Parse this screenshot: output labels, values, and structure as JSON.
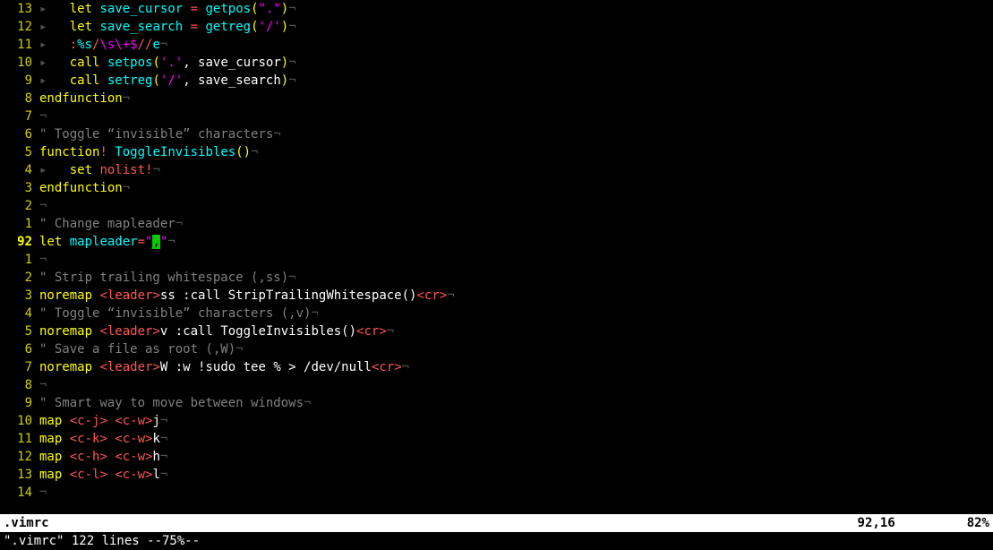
{
  "lines": [
    {
      "rel": "13",
      "current": false,
      "tokens": [
        [
          "tab",
          "▸   "
        ],
        [
          "kw",
          "let"
        ],
        [
          "plain",
          " "
        ],
        [
          "ident",
          "save_cursor"
        ],
        [
          "plain",
          " "
        ],
        [
          "op",
          "="
        ],
        [
          "plain",
          " "
        ],
        [
          "func",
          "getpos"
        ],
        [
          "paren",
          "("
        ],
        [
          "str",
          "\".\""
        ],
        [
          "paren",
          ")"
        ],
        [
          "eol",
          "¬"
        ]
      ]
    },
    {
      "rel": "12",
      "current": false,
      "tokens": [
        [
          "tab",
          "▸   "
        ],
        [
          "kw",
          "let"
        ],
        [
          "plain",
          " "
        ],
        [
          "ident",
          "save_search"
        ],
        [
          "plain",
          " "
        ],
        [
          "op",
          "="
        ],
        [
          "plain",
          " "
        ],
        [
          "func",
          "getreg"
        ],
        [
          "paren",
          "("
        ],
        [
          "str",
          "'/'"
        ],
        [
          "paren",
          ")"
        ],
        [
          "eol",
          "¬"
        ]
      ]
    },
    {
      "rel": "11",
      "current": false,
      "tokens": [
        [
          "tab",
          "▸   "
        ],
        [
          "op",
          ":"
        ],
        [
          "func",
          "%s"
        ],
        [
          "op",
          "/"
        ],
        [
          "str",
          "\\s\\+$"
        ],
        [
          "op",
          "//"
        ],
        [
          "func",
          "e"
        ],
        [
          "eol",
          "¬"
        ]
      ]
    },
    {
      "rel": "10",
      "current": false,
      "tokens": [
        [
          "tab",
          "▸   "
        ],
        [
          "kw",
          "call"
        ],
        [
          "plain",
          " "
        ],
        [
          "func",
          "setpos"
        ],
        [
          "paren",
          "("
        ],
        [
          "str",
          "'.'"
        ],
        [
          "plain",
          ", save_cursor"
        ],
        [
          "paren",
          ")"
        ],
        [
          "eol",
          "¬"
        ]
      ]
    },
    {
      "rel": "9",
      "current": false,
      "tokens": [
        [
          "tab",
          "▸   "
        ],
        [
          "kw",
          "call"
        ],
        [
          "plain",
          " "
        ],
        [
          "func",
          "setreg"
        ],
        [
          "paren",
          "("
        ],
        [
          "str",
          "'/'"
        ],
        [
          "plain",
          ", save_search"
        ],
        [
          "paren",
          ")"
        ],
        [
          "eol",
          "¬"
        ]
      ]
    },
    {
      "rel": "8",
      "current": false,
      "tokens": [
        [
          "kw",
          "endfunction"
        ],
        [
          "eol",
          "¬"
        ]
      ]
    },
    {
      "rel": "7",
      "current": false,
      "tokens": [
        [
          "eol",
          "¬"
        ]
      ]
    },
    {
      "rel": "6",
      "current": false,
      "tokens": [
        [
          "comment",
          "\" Toggle “invisible” characters"
        ],
        [
          "eol",
          "¬"
        ]
      ]
    },
    {
      "rel": "5",
      "current": false,
      "tokens": [
        [
          "kw",
          "function"
        ],
        [
          "op",
          "!"
        ],
        [
          "plain",
          " "
        ],
        [
          "func",
          "ToggleInvisibles"
        ],
        [
          "paren",
          "()"
        ],
        [
          "eol",
          "¬"
        ]
      ]
    },
    {
      "rel": "4",
      "current": false,
      "tokens": [
        [
          "tab",
          "▸   "
        ],
        [
          "kw",
          "set"
        ],
        [
          "plain",
          " "
        ],
        [
          "option",
          "nolist!"
        ],
        [
          "eol",
          "¬"
        ]
      ]
    },
    {
      "rel": "3",
      "current": false,
      "tokens": [
        [
          "kw",
          "endfunction"
        ],
        [
          "eol",
          "¬"
        ]
      ]
    },
    {
      "rel": "2",
      "current": false,
      "tokens": [
        [
          "eol",
          "¬"
        ]
      ]
    },
    {
      "rel": "1",
      "current": false,
      "tokens": [
        [
          "comment",
          "\" Change mapleader"
        ],
        [
          "eol",
          "¬"
        ]
      ]
    },
    {
      "rel": "92",
      "current": true,
      "tokens": [
        [
          "kw",
          "let"
        ],
        [
          "plain",
          " "
        ],
        [
          "ident",
          "mapleader"
        ],
        [
          "op",
          "="
        ],
        [
          "str",
          "\""
        ],
        [
          "cursor",
          ","
        ],
        [
          "str",
          "\""
        ],
        [
          "eol",
          "¬"
        ]
      ]
    },
    {
      "rel": "1",
      "current": false,
      "tokens": [
        [
          "eol",
          "¬"
        ]
      ]
    },
    {
      "rel": "2",
      "current": false,
      "tokens": [
        [
          "comment",
          "\" Strip trailing whitespace (,ss)"
        ],
        [
          "eol",
          "¬"
        ]
      ]
    },
    {
      "rel": "3",
      "current": false,
      "tokens": [
        [
          "kw",
          "noremap"
        ],
        [
          "plain",
          " "
        ],
        [
          "key",
          "<leader>"
        ],
        [
          "plain",
          "ss :call StripTrailingWhitespace()"
        ],
        [
          "key",
          "<cr>"
        ],
        [
          "eol",
          "¬"
        ]
      ]
    },
    {
      "rel": "4",
      "current": false,
      "tokens": [
        [
          "comment",
          "\" Toggle “invisible” characters (,v)"
        ],
        [
          "eol",
          "¬"
        ]
      ]
    },
    {
      "rel": "5",
      "current": false,
      "tokens": [
        [
          "kw",
          "noremap"
        ],
        [
          "plain",
          " "
        ],
        [
          "key",
          "<leader>"
        ],
        [
          "plain",
          "v :call ToggleInvisibles()"
        ],
        [
          "key",
          "<cr>"
        ],
        [
          "eol",
          "¬"
        ]
      ]
    },
    {
      "rel": "6",
      "current": false,
      "tokens": [
        [
          "comment",
          "\" Save a file as root (,W)"
        ],
        [
          "eol",
          "¬"
        ]
      ]
    },
    {
      "rel": "7",
      "current": false,
      "tokens": [
        [
          "kw",
          "noremap"
        ],
        [
          "plain",
          " "
        ],
        [
          "key",
          "<leader>"
        ],
        [
          "plain",
          "W :w !sudo tee % > /dev/null"
        ],
        [
          "key",
          "<cr>"
        ],
        [
          "eol",
          "¬"
        ]
      ]
    },
    {
      "rel": "8",
      "current": false,
      "tokens": [
        [
          "eol",
          "¬"
        ]
      ]
    },
    {
      "rel": "9",
      "current": false,
      "tokens": [
        [
          "comment",
          "\" Smart way to move between windows"
        ],
        [
          "eol",
          "¬"
        ]
      ]
    },
    {
      "rel": "10",
      "current": false,
      "tokens": [
        [
          "kw",
          "map"
        ],
        [
          "plain",
          " "
        ],
        [
          "key",
          "<c-j>"
        ],
        [
          "plain",
          " "
        ],
        [
          "key",
          "<c-w>"
        ],
        [
          "plain",
          "j"
        ],
        [
          "eol",
          "¬"
        ]
      ]
    },
    {
      "rel": "11",
      "current": false,
      "tokens": [
        [
          "kw",
          "map"
        ],
        [
          "plain",
          " "
        ],
        [
          "key",
          "<c-k>"
        ],
        [
          "plain",
          " "
        ],
        [
          "key",
          "<c-w>"
        ],
        [
          "plain",
          "k"
        ],
        [
          "eol",
          "¬"
        ]
      ]
    },
    {
      "rel": "12",
      "current": false,
      "tokens": [
        [
          "kw",
          "map"
        ],
        [
          "plain",
          " "
        ],
        [
          "key",
          "<c-h>"
        ],
        [
          "plain",
          " "
        ],
        [
          "key",
          "<c-w>"
        ],
        [
          "plain",
          "h"
        ],
        [
          "eol",
          "¬"
        ]
      ]
    },
    {
      "rel": "13",
      "current": false,
      "tokens": [
        [
          "kw",
          "map"
        ],
        [
          "plain",
          " "
        ],
        [
          "key",
          "<c-l>"
        ],
        [
          "plain",
          " "
        ],
        [
          "key",
          "<c-w>"
        ],
        [
          "plain",
          "l"
        ],
        [
          "eol",
          "¬"
        ]
      ]
    },
    {
      "rel": "14",
      "current": false,
      "tokens": [
        [
          "eol",
          "¬"
        ]
      ]
    }
  ],
  "status": {
    "filename": ".vimrc",
    "position": "92,16",
    "percent": "82%"
  },
  "cmdline": "\".vimrc\" 122 lines --75%--"
}
